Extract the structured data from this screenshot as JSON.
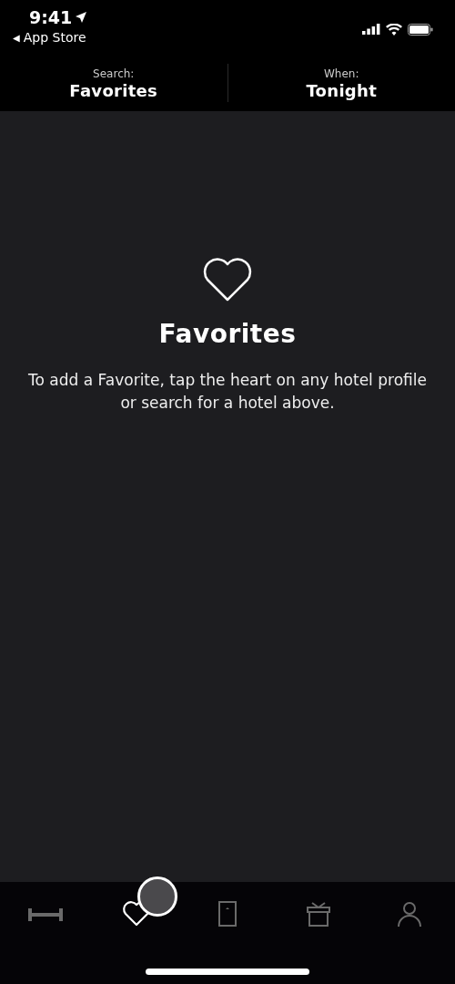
{
  "status_bar": {
    "time": "9:41",
    "back_label": "App Store",
    "back_arrow": "◀"
  },
  "header": {
    "fields": [
      {
        "label": "Search:",
        "value": "Favorites"
      },
      {
        "label": "When:",
        "value": "Tonight"
      }
    ]
  },
  "empty_state": {
    "title": "Favorites",
    "message": "To add a Favorite, tap the heart on any hotel profile or search for a hotel above."
  },
  "tab_bar": {
    "tabs": [
      {
        "kind": "bed",
        "selected": false
      },
      {
        "kind": "heart",
        "selected": true
      },
      {
        "kind": "door",
        "selected": false
      },
      {
        "kind": "gift",
        "selected": false
      },
      {
        "kind": "person",
        "selected": false
      }
    ]
  }
}
